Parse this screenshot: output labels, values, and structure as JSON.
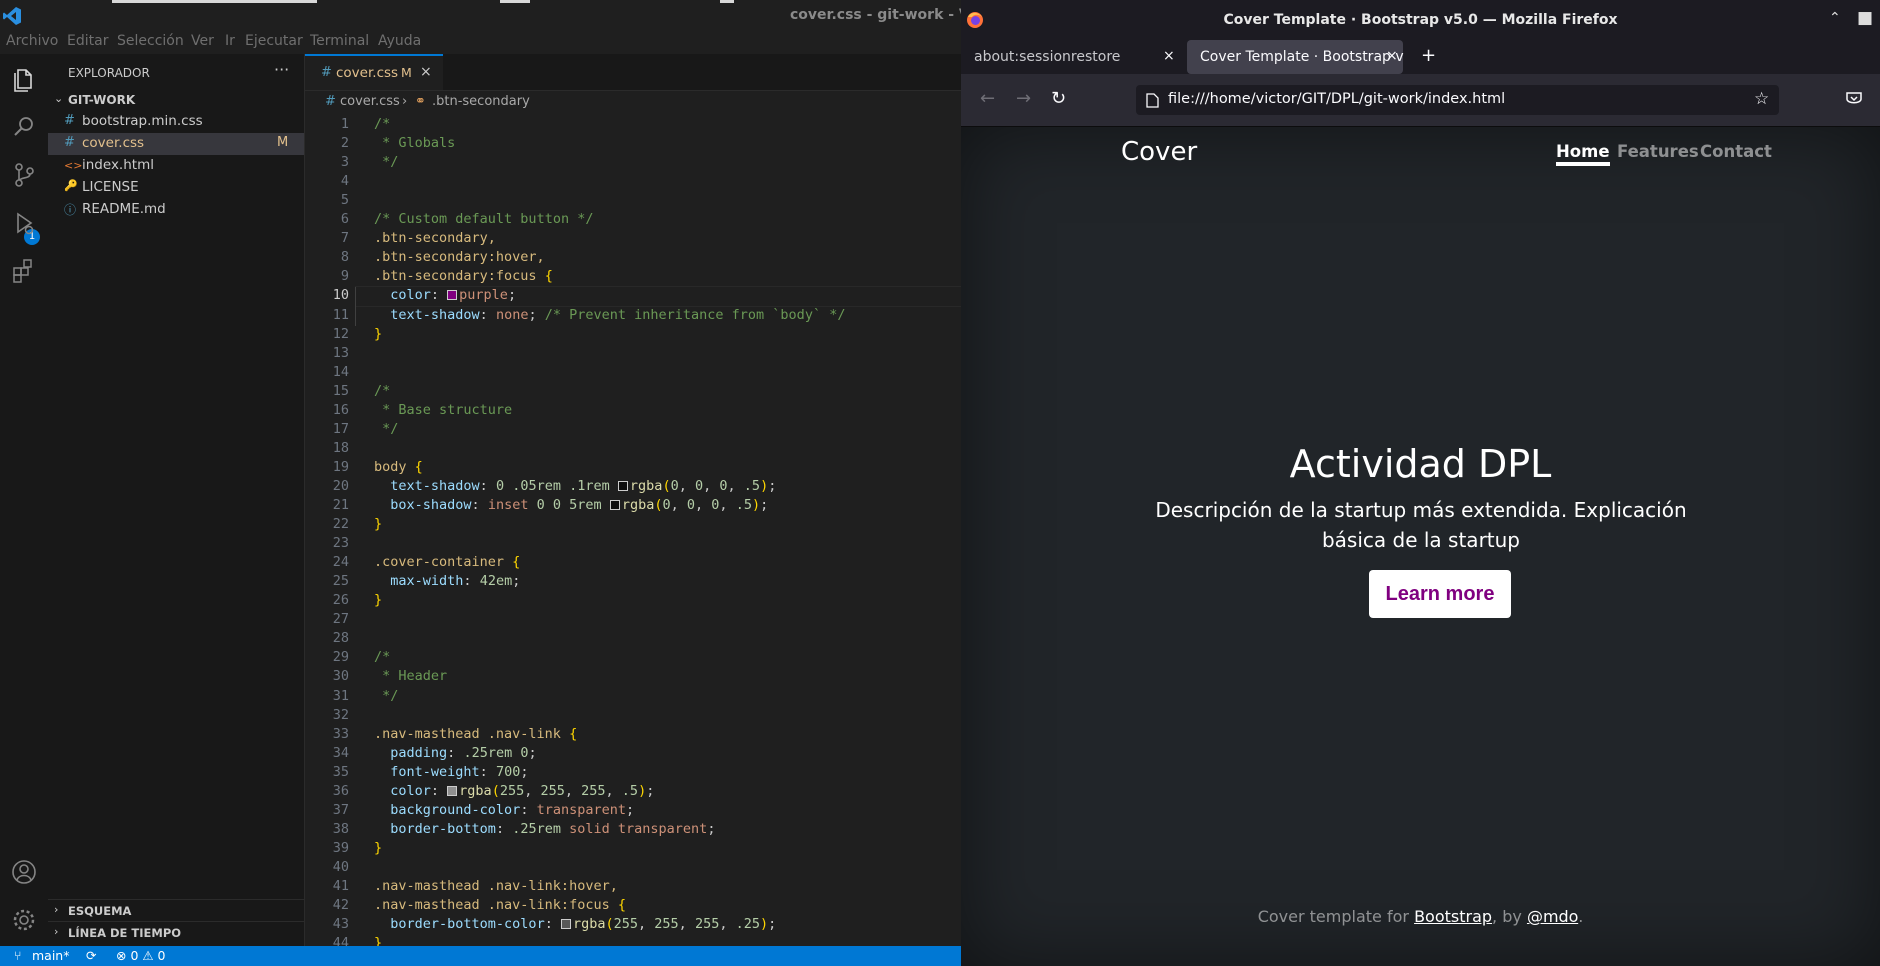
{
  "vscode": {
    "window_title": "cover.css - git-work - Visu",
    "menu": [
      "Archivo",
      "Editar",
      "Selección",
      "Ver",
      "Ir",
      "Ejecutar",
      "Terminal",
      "Ayuda"
    ],
    "sidebar": {
      "title": "EXPLORADOR",
      "more": "···",
      "folder": "GIT-WORK",
      "files": [
        {
          "icon": "#",
          "name": "bootstrap.min.css",
          "status": ""
        },
        {
          "icon": "#",
          "name": "cover.css",
          "status": "M"
        },
        {
          "icon": "<>",
          "name": "index.html",
          "status": ""
        },
        {
          "icon": "🔑",
          "name": "LICENSE",
          "status": ""
        },
        {
          "icon": "ⓘ",
          "name": "README.md",
          "status": ""
        }
      ],
      "sections": [
        "ESQUEMA",
        "LÍNEA DE TIEMPO"
      ]
    },
    "activity_badge": "1",
    "tab": {
      "name": "cover.css",
      "status": "M",
      "close": "×"
    },
    "breadcrumb": {
      "file": "cover.css",
      "symbol": ".btn-secondary"
    },
    "current_line": 10,
    "code": [
      "/*",
      " * Globals",
      " */",
      "",
      "",
      "/* Custom default button */",
      ".btn-secondary,",
      ".btn-secondary:hover,",
      ".btn-secondary:focus {",
      "  color: purple;",
      "  text-shadow: none; /* Prevent inheritance from `body` */",
      "}",
      "",
      "",
      "/*",
      " * Base structure",
      " */",
      "",
      "body {",
      "  text-shadow: 0 .05rem .1rem rgba(0, 0, 0, .5);",
      "  box-shadow: inset 0 0 5rem rgba(0, 0, 0, .5);",
      "}",
      "",
      ".cover-container {",
      "  max-width: 42em;",
      "}",
      "",
      "",
      "/*",
      " * Header",
      " */",
      "",
      ".nav-masthead .nav-link {",
      "  padding: .25rem 0;",
      "  font-weight: 700;",
      "  color: rgba(255, 255, 255, .5);",
      "  background-color: transparent;",
      "  border-bottom: .25rem solid transparent;",
      "}",
      "",
      ".nav-masthead .nav-link:hover,",
      ".nav-masthead .nav-link:focus {",
      "  border-bottom-color: rgba(255, 255, 255, .25);",
      "}"
    ],
    "status": {
      "branch": "main*",
      "sync": "⟳",
      "problems": "⊗ 0 ⚠ 0"
    }
  },
  "firefox": {
    "window_title": "Cover Template · Bootstrap v5.0 — Mozilla Firefox",
    "tabs": [
      {
        "title": "about:sessionrestore",
        "close": "×"
      },
      {
        "title": "Cover Template · Bootstrap v",
        "close": "×"
      }
    ],
    "new_tab": "+",
    "url": "file:///home/victor/GIT/DPL/git-work/index.html",
    "page": {
      "brand": "Cover",
      "nav": [
        "Home",
        "Features",
        "Contact"
      ],
      "title": "Actividad DPL",
      "lead": "Descripción de la startup más extendida. Explicación básica de la startup",
      "button": "Learn more",
      "footer": {
        "prefix": "Cover template for ",
        "link1": "Bootstrap",
        "middle": ", by ",
        "link2": "@mdo",
        "suffix": "."
      }
    }
  },
  "colors": {
    "accent": "#0078d4",
    "button_text": "purple",
    "page_bg": "#212529"
  }
}
